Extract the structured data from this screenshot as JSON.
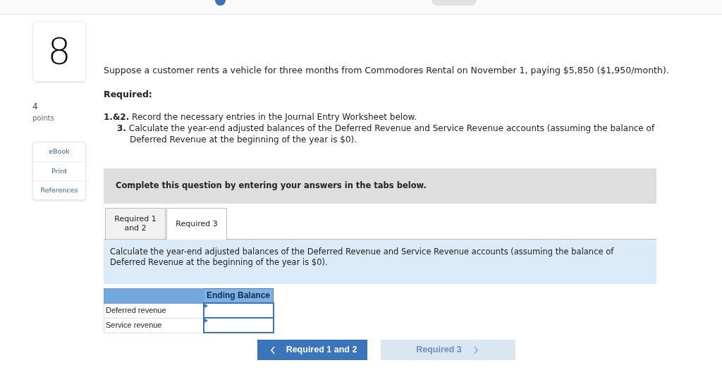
{
  "question": {
    "number": "8",
    "points_value": "4",
    "points_label": "points"
  },
  "side_links": [
    {
      "label": "eBook"
    },
    {
      "label": "Print"
    },
    {
      "label": "References"
    }
  ],
  "intro": "Suppose a customer rents a vehicle for three months from Commodores Rental on November 1, paying $5,850 ($1,950/month).",
  "required_heading": "Required:",
  "requirements": [
    {
      "number": "1.&2.",
      "text": "Record the necessary entries in the Journal Entry Worksheet below.",
      "indented": false
    },
    {
      "number": "3.",
      "text": "Calculate the year-end adjusted balances of the Deferred Revenue and Service Revenue accounts (assuming the balance of Deferred Revenue at the beginning of the year is $0).",
      "indented": true
    }
  ],
  "instruction_banner": "Complete this question by entering your answers in the tabs below.",
  "tabs": [
    {
      "label": "Required 1 and 2",
      "selected": false
    },
    {
      "label": "Required 3",
      "selected": true
    }
  ],
  "tab_prompt": "Calculate the year-end adjusted balances of the Deferred Revenue and Service Revenue accounts (assuming the balance of Deferred Revenue at the beginning of the year is $0).",
  "table": {
    "columns": [
      "Ending Balance"
    ],
    "rows": [
      {
        "label": "Deferred revenue"
      },
      {
        "label": "Service revenue"
      }
    ]
  },
  "nav_buttons": [
    {
      "label": "Required 1 and 2",
      "kind": "prev",
      "disabled": false
    },
    {
      "label": "Required 3",
      "kind": "next",
      "disabled": true
    }
  ]
}
